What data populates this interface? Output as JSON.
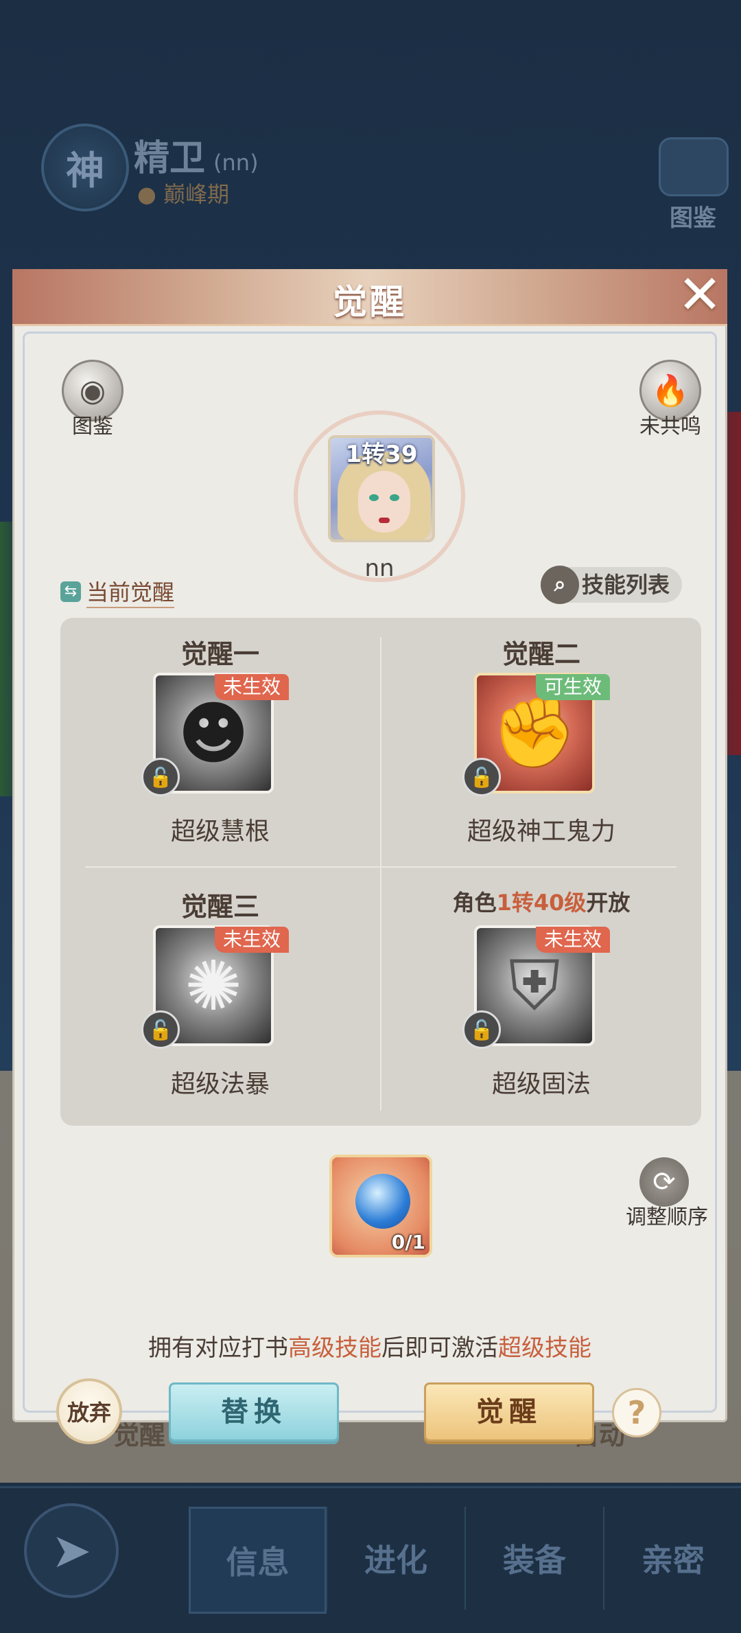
{
  "background": {
    "god_badge": "神",
    "hero_name": "精卫",
    "hero_tag": "(nn)",
    "hero_stage": "巅峰期",
    "atlas_label": "图鉴",
    "lower_left_label": "觉醒",
    "lower_right_label": "自动",
    "nav_tabs": [
      "信息",
      "进化",
      "装备",
      "亲密"
    ],
    "nav_back_icon": "back-arrow-icon"
  },
  "modal": {
    "title": "觉醒",
    "close_icon": "close-icon",
    "atlas_label": "图鉴",
    "resonance_label": "未共鸣",
    "portrait": {
      "level": "1转39",
      "name": "nn"
    },
    "current_awaken_label": "当前觉醒",
    "skill_list_label": "技能列表",
    "slots": [
      {
        "title": "觉醒一",
        "badge": "未生效",
        "badge_color": "#e0664e",
        "skill_name": "超级慧根",
        "icon": "mask-icon"
      },
      {
        "title": "觉醒二",
        "badge": "可生效",
        "badge_color": "#6dbb79",
        "skill_name": "超级神工鬼力",
        "icon": "fist-icon"
      },
      {
        "title": "觉醒三",
        "badge": "未生效",
        "badge_color": "#e0664e",
        "skill_name": "超级法暴",
        "icon": "burst-icon"
      },
      {
        "title_prefix": "角色",
        "title_highlight": "1转40级",
        "title_suffix": "开放",
        "badge": "未生效",
        "badge_color": "#e0664e",
        "skill_name": "超级固法",
        "icon": "shield-icon"
      }
    ],
    "item": {
      "count": "0/1",
      "icon": "spirit-orb-icon"
    },
    "reorder_label": "调整顺序",
    "hint": {
      "part1": "拥有对应打书",
      "highlight1": "高级技能",
      "part2": "后即可激活",
      "highlight2": "超级技能"
    },
    "buttons": {
      "abandon": "放弃",
      "replace": "替换",
      "awaken": "觉醒",
      "help": "?"
    },
    "colors": {
      "highlight": "#c85f3c",
      "title_bar": "#cfa58d"
    }
  }
}
